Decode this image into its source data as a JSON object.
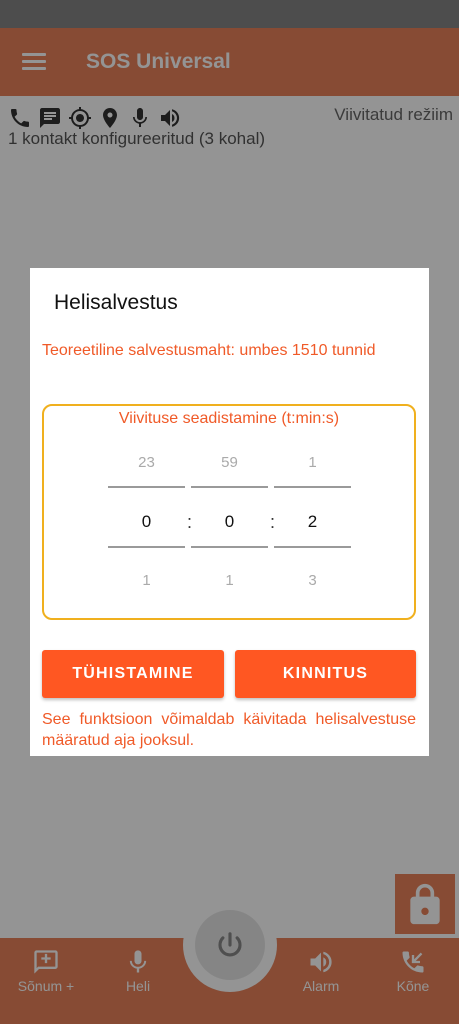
{
  "app": {
    "title": "SOS Universal"
  },
  "status": {
    "icons": [
      "phone-icon",
      "message-icon",
      "gps-target-icon",
      "location-pin-icon",
      "microphone-icon",
      "speaker-icon"
    ],
    "mode": "Viivitatud režiim",
    "contacts": "1 kontakt konfigureeritud (3 kohal)"
  },
  "dialog": {
    "title": "Helisalvestus",
    "capacity": "Teoreetiline salvestusmaht: umbes 1510 tunnid",
    "picker_label": "Viivituse seadistamine (t:min:s)",
    "hours": {
      "prev": "23",
      "current": "0",
      "next": "1"
    },
    "minutes": {
      "prev": "59",
      "current": "0",
      "next": "1"
    },
    "seconds": {
      "prev": "1",
      "current": "2",
      "next": "3"
    },
    "separator": ":",
    "cancel_label": "TÜHISTAMINE",
    "confirm_label": "KINNITUS",
    "description": "See funktsioon võimaldab käivitada helisalvestuse määratud aja jooksul."
  },
  "nav": {
    "sms": "Sõnum +",
    "voice": "Heli",
    "alarm": "Alarm",
    "call": "Kõne"
  },
  "colors": {
    "accent": "#ff5722",
    "appbar": "#e8825a",
    "picker_border": "#f0b01e",
    "text_accent": "#f05a28"
  }
}
